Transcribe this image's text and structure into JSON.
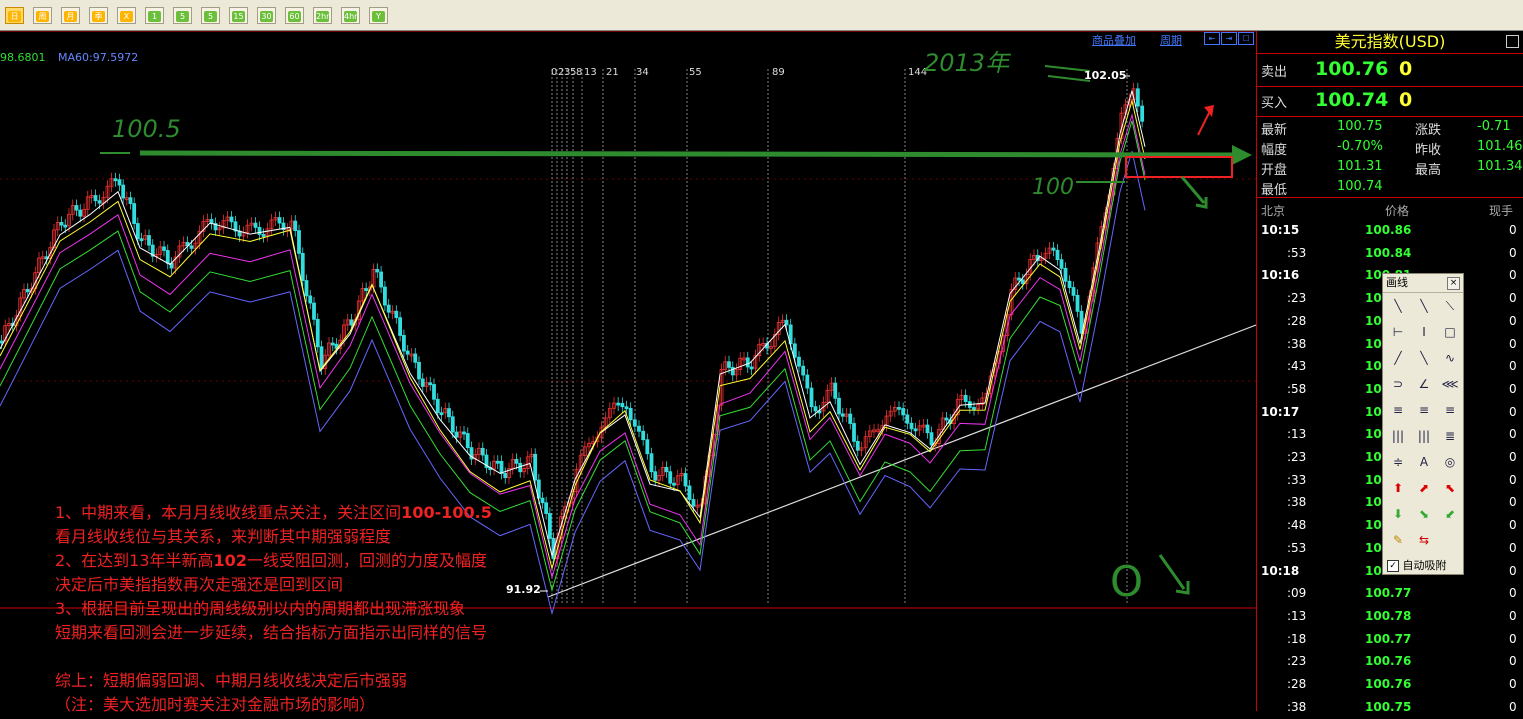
{
  "toolbar": {
    "buttons": [
      "日",
      "周",
      "月",
      "季",
      "X",
      "1",
      "5",
      "5",
      "15",
      "30",
      "60",
      "2hr",
      "4hr",
      "Y"
    ]
  },
  "chart": {
    "ma_readout_a": "98.6801",
    "ma_readout_b": "MA60:97.5972",
    "link_overlay": "商品叠加",
    "link_period": "周期",
    "fib_labels": [
      "0",
      "2",
      "3",
      "5",
      "8",
      "13",
      "21",
      "34",
      "55",
      "89",
      "144"
    ],
    "price_high": "102.05",
    "price_low": "91.92",
    "hand_1005": "100.5",
    "hand_100": "100",
    "hand_year": "2013年",
    "hand_o": "O",
    "annotations": [
      "1、中期来看，本月月线收线重点关注，关注区间",
      "100-100.5",
      "看月线收线位与其关系，来判断其中期强弱程度",
      "2、在达到13年半新高",
      "102",
      "一线受阻回测，回测的力度及幅度",
      "决定后市美指指数再次走强还是回到区间",
      "3、根据目前呈现出的周线级别以内的周期都出现滞涨现象",
      "短期来看回测会进一步延续，结合指标方面指示出同样的信号",
      "综上：短期偏弱回调、中期月线收线决定后市强弱",
      "（注：美大选加时赛关注对金融市场的影响）"
    ]
  },
  "quote": {
    "title": "美元指数(USD)",
    "sell_label": "卖出",
    "sell_price": "100.76",
    "sell_vol": "0",
    "buy_label": "买入",
    "buy_price": "100.74",
    "buy_vol": "0",
    "stats": [
      {
        "l": "最新",
        "v": "100.75",
        "l2": "涨跌",
        "v2": "-0.71"
      },
      {
        "l": "幅度",
        "v": "-0.70%",
        "l2": "昨收",
        "v2": "101.46"
      },
      {
        "l": "开盘",
        "v": "101.31",
        "l2": "最高",
        "v2": "101.34"
      },
      {
        "l": "最低",
        "v": "100.74",
        "l2": "",
        "v2": ""
      }
    ],
    "tick_headers": [
      "北京",
      "价格",
      "现手"
    ],
    "ticks": [
      {
        "t": "10:15",
        "p": "100.86",
        "v": "0",
        "b": true
      },
      {
        "t": ":53",
        "p": "100.84",
        "v": "0",
        "b": false
      },
      {
        "t": "10:16",
        "p": "100.81",
        "v": "0",
        "b": true
      },
      {
        "t": ":23",
        "p": "100.80",
        "v": "0",
        "b": false
      },
      {
        "t": ":28",
        "p": "100.80",
        "v": "0",
        "b": false
      },
      {
        "t": ":38",
        "p": "100.79",
        "v": "0",
        "b": false
      },
      {
        "t": ":43",
        "p": "100.78",
        "v": "0",
        "b": false
      },
      {
        "t": ":58",
        "p": "100.78",
        "v": "0",
        "b": false
      },
      {
        "t": "10:17",
        "p": "100.78",
        "v": "0",
        "b": true
      },
      {
        "t": ":13",
        "p": "100.77",
        "v": "0",
        "b": false
      },
      {
        "t": ":23",
        "p": "100.77",
        "v": "0",
        "b": false
      },
      {
        "t": ":33",
        "p": "100.77",
        "v": "0",
        "b": false
      },
      {
        "t": ":38",
        "p": "100.77",
        "v": "0",
        "b": false
      },
      {
        "t": ":48",
        "p": "100.77",
        "v": "0",
        "b": false
      },
      {
        "t": ":53",
        "p": "100.77",
        "v": "0",
        "b": false
      },
      {
        "t": "10:18",
        "p": "100.77",
        "v": "0",
        "b": true
      },
      {
        "t": ":09",
        "p": "100.77",
        "v": "0",
        "b": false
      },
      {
        "t": ":13",
        "p": "100.78",
        "v": "0",
        "b": false
      },
      {
        "t": ":18",
        "p": "100.77",
        "v": "0",
        "b": false
      },
      {
        "t": ":23",
        "p": "100.76",
        "v": "0",
        "b": false
      },
      {
        "t": ":28",
        "p": "100.76",
        "v": "0",
        "b": false
      },
      {
        "t": ":38",
        "p": "100.75",
        "v": "0",
        "b": false
      }
    ]
  },
  "draw_panel": {
    "title": "画线",
    "close": "×",
    "auto_snap": "自动吸附",
    "tools": [
      "╲",
      "╲",
      "⟍",
      "⊢",
      "Ⅰ",
      "□",
      "╱",
      "╲",
      "∿",
      "⊃",
      "∠",
      "⋘",
      "≡",
      "≡",
      "≡",
      "|||",
      "|||",
      "≣",
      "≑",
      "A",
      "◎",
      "⬆",
      "⬈",
      "⬉",
      "⬇",
      "⬊",
      "⬋",
      "✎",
      "⇆"
    ],
    "tool_colors": [
      "#224",
      "#224",
      "#224",
      "#224",
      "#224",
      "#224",
      "#224",
      "#224",
      "#224",
      "#224",
      "#224",
      "#224",
      "#224",
      "#224",
      "#224",
      "#224",
      "#224",
      "#224",
      "#224",
      "#224",
      "#224",
      "#d00",
      "#d00",
      "#d00",
      "#3a3",
      "#3a3",
      "#3a3",
      "#b80",
      "#c00"
    ]
  }
}
